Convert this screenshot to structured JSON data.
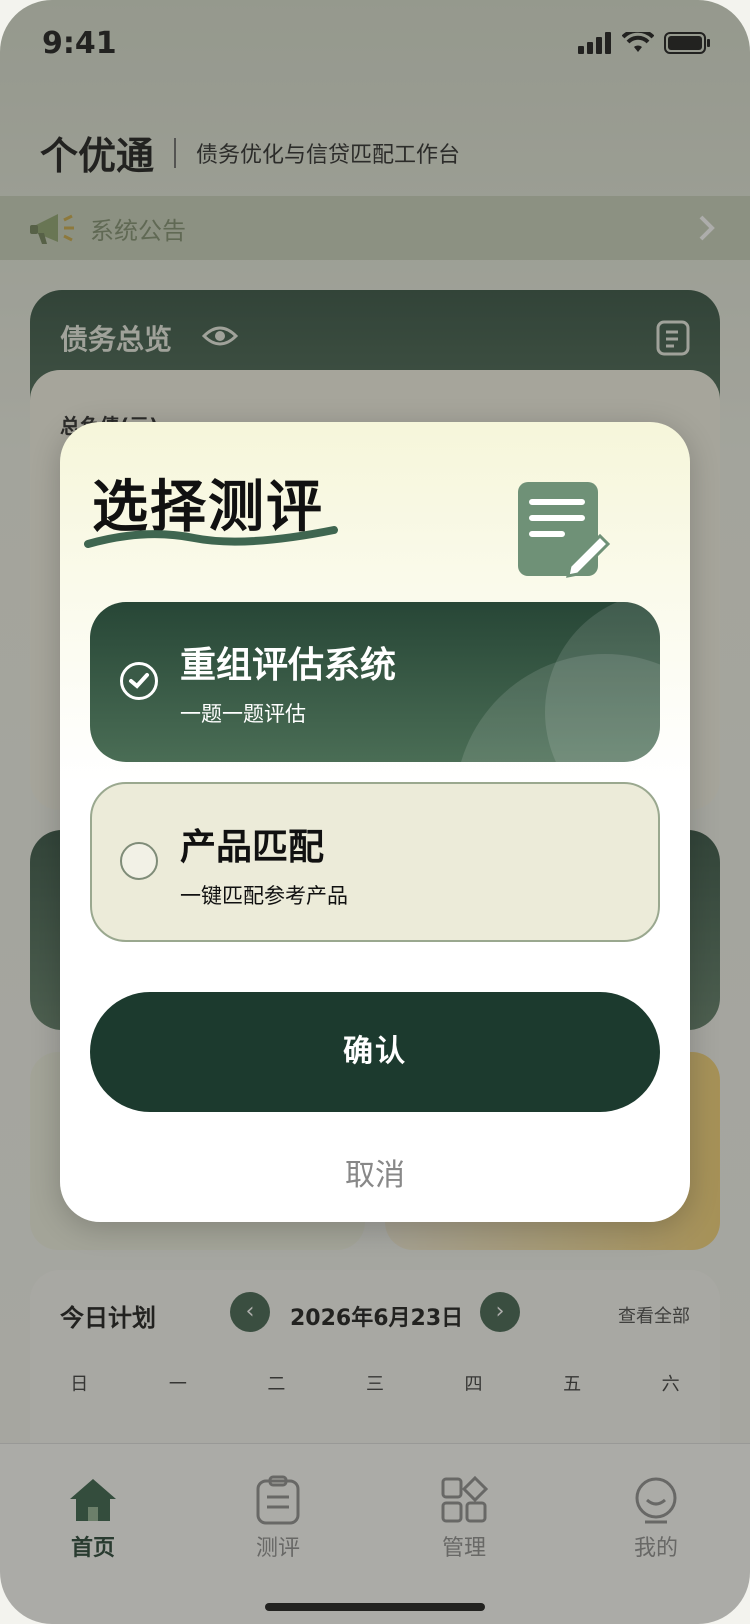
{
  "status": {
    "time": "9:41"
  },
  "header": {
    "brand": "个优通",
    "subtitle": "债务优化与信贷匹配工作台"
  },
  "notice": {
    "label": "系统公告"
  },
  "overview": {
    "title": "债务总览",
    "total_label": "总负债(元)"
  },
  "plan": {
    "title": "今日计划",
    "date": "2026年6月23日",
    "view_all": "查看全部",
    "weekdays": [
      "日",
      "一",
      "二",
      "三",
      "四",
      "五",
      "六"
    ]
  },
  "tabs": [
    {
      "label": "首页",
      "icon": "home-icon",
      "active": true
    },
    {
      "label": "测评",
      "icon": "clipboard-icon",
      "active": false
    },
    {
      "label": "管理",
      "icon": "grid-icon",
      "active": false
    },
    {
      "label": "我的",
      "icon": "user-icon",
      "active": false
    }
  ],
  "modal": {
    "title": "选择测评",
    "options": [
      {
        "name": "重组评估系统",
        "desc": "一题一题评估",
        "selected": true
      },
      {
        "name": "产品匹配",
        "desc": "一键匹配参考产品",
        "selected": false
      }
    ],
    "confirm": "确认",
    "cancel": "取消"
  },
  "colors": {
    "accent": "#1c3a2e",
    "selected_card": "#2f4f3d",
    "unselected_card": "#ecebd9"
  }
}
